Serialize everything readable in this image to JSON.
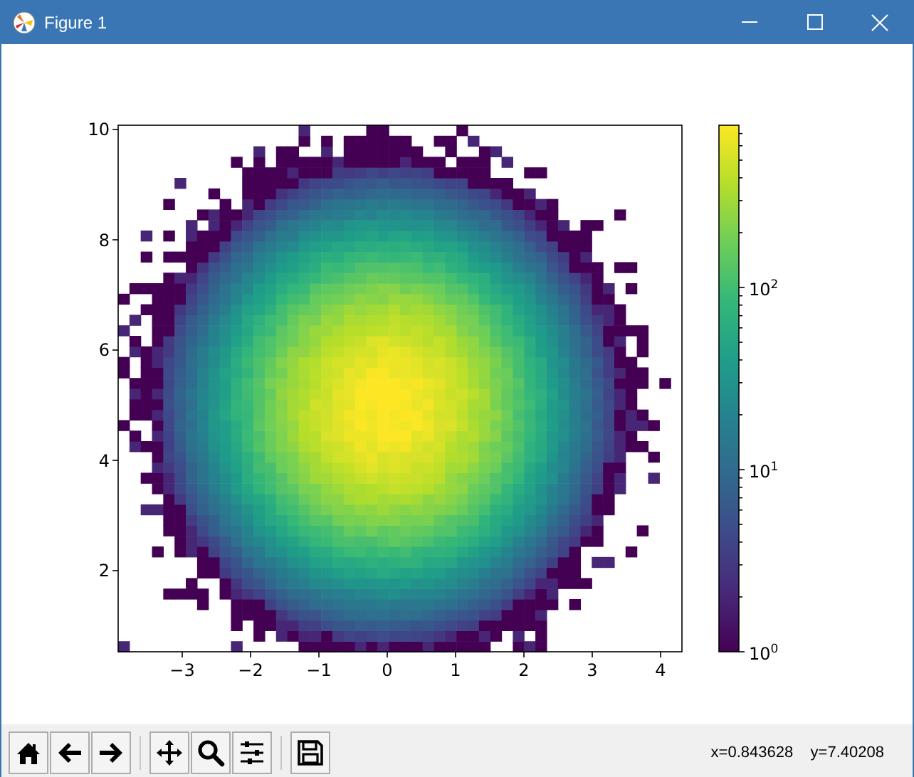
{
  "window": {
    "title": "Figure 1"
  },
  "figure": {
    "x_tick_labels": [
      "−3",
      "−2",
      "−1",
      "0",
      "1",
      "2",
      "3",
      "4"
    ],
    "y_tick_labels": [
      "10",
      "8",
      "6",
      "4",
      "2"
    ],
    "colorbar_tick_labels": [
      "10$^{2}$",
      "10$^{1}$",
      "10$^{0}$"
    ]
  },
  "toolbar": {
    "items": [
      {
        "kind": "home"
      },
      {
        "kind": "back"
      },
      {
        "kind": "forward"
      },
      {
        "kind": "separator"
      },
      {
        "kind": "pan"
      },
      {
        "kind": "zoom"
      },
      {
        "kind": "configure"
      },
      {
        "kind": "separator"
      },
      {
        "kind": "save"
      }
    ],
    "readout": "x=0.843628    y=7.40208"
  }
}
